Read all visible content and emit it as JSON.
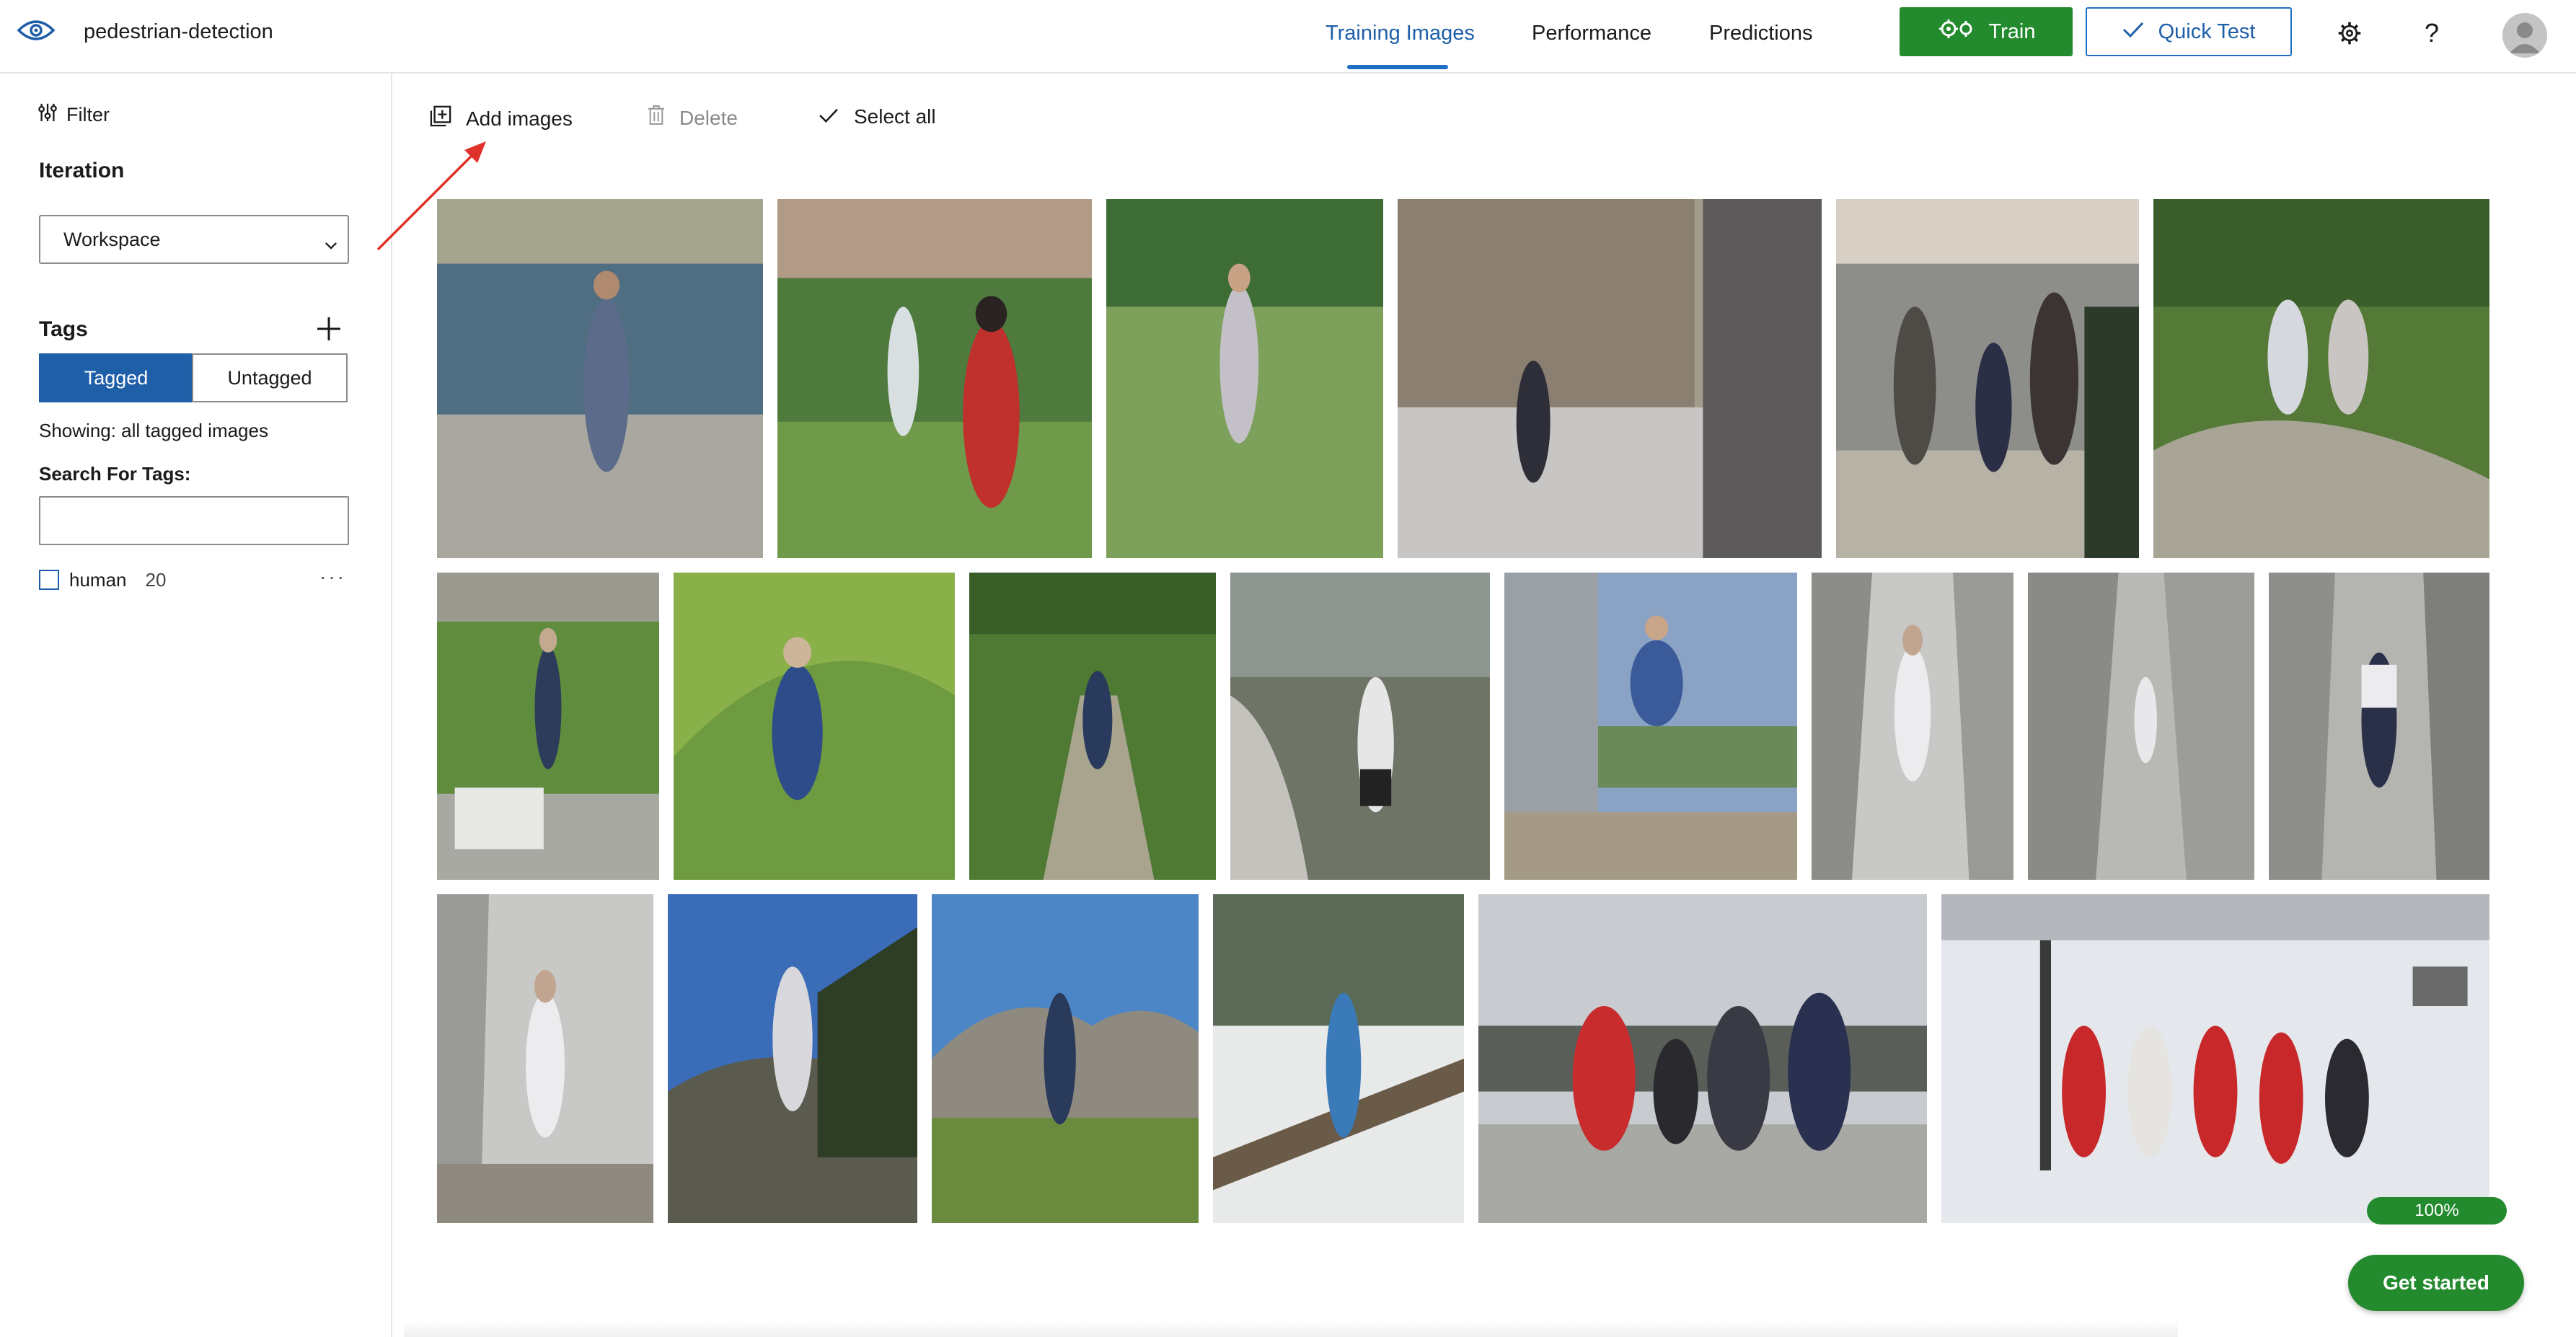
{
  "header": {
    "project_name": "pedestrian-detection",
    "tabs": [
      {
        "label": "Training Images",
        "active": true
      },
      {
        "label": "Performance",
        "active": false
      },
      {
        "label": "Predictions",
        "active": false
      }
    ],
    "train_label": "Train",
    "quick_test_label": "Quick Test",
    "settings_icon": "gear-icon",
    "help_label": "?",
    "accent_color": "#1f5fa8",
    "train_color": "#238a2e"
  },
  "sidebar": {
    "filter_label": "Filter",
    "iteration_label": "Iteration",
    "iteration_value": "Workspace",
    "tags_label": "Tags",
    "tagged_label": "Tagged",
    "untagged_label": "Untagged",
    "showing_text": "Showing: all tagged images",
    "search_label": "Search For Tags:",
    "search_value": "",
    "tags": [
      {
        "name": "human",
        "count": "20"
      }
    ],
    "more_label": "···"
  },
  "toolbar": {
    "add_images_label": "Add images",
    "delete_label": "Delete",
    "select_all_label": "Select all"
  },
  "images": {
    "count": 20,
    "scenes": [
      "lake-shore",
      "garden-building",
      "lawn",
      "cathedral-square",
      "market-street",
      "hill-hikers",
      "terrace-garden",
      "grassy-slope",
      "mountain-trail",
      "rock-cliff",
      "balcony-jump",
      "rock-crevice",
      "narrow-gorge",
      "rock-wall",
      "rock-face",
      "hill-summit",
      "mountain-meadow",
      "snowy-fence",
      "snow-parking",
      "ski-slope"
    ]
  },
  "progress_label": "100%",
  "get_started_label": "Get started"
}
